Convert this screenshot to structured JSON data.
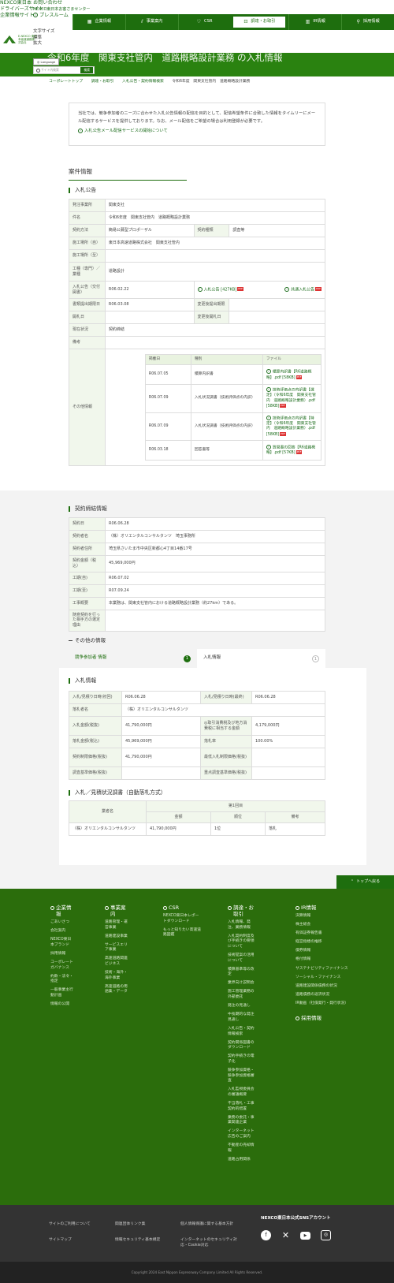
{
  "utility": {
    "links": [
      "NEXCO東日本",
      "ドライバーズサイト",
      "企業情報サイト",
      "お問い合わせ",
      "NEXCO東日本お客さまセンター",
      "プレスルーム"
    ],
    "font_size_label": "文字サイズ",
    "font_sizes": [
      "標準",
      "拡大"
    ],
    "logo_text": "E-NEXCO 東日本高速道路株式会社"
  },
  "gnav": {
    "items": [
      {
        "label": "企業情報",
        "icon": "building-icon"
      },
      {
        "label": "事業案内",
        "icon": "road-icon"
      },
      {
        "label": "CSR",
        "icon": "heart-icon"
      },
      {
        "label": "調達・お取引",
        "icon": "handshake-icon"
      },
      {
        "label": "IR情報",
        "icon": "chart-icon"
      },
      {
        "label": "採用情報",
        "icon": "person-icon"
      }
    ],
    "active_index": 3
  },
  "page": {
    "title": "令和6年度　関東支社管内　道路概略設計業務 の入札情報",
    "language_label": "Language",
    "search_placeholder": "サイト内検索",
    "search_button": "検索",
    "breadcrumb": [
      "コーポレートトップ",
      "調達・お取引",
      "入札公告・契約情報検索",
      "令和6年度　関東支社管内　道路概略設計業務"
    ]
  },
  "intro": {
    "text": "当社では、競争参加者のニーズに合わせた入札公告情報の配信を目的として、配信希望条件に合致した情報をタイムリーにメール配信するサービスを提供しております。なお、メール配信をご希望の場合は利用登録が必要です。",
    "link": "入札公告メール配信サービスの開始について"
  },
  "case": {
    "section_title": "案件情報",
    "subtitle": "入札公告",
    "rows": {
      "orderer_label": "発注事業所",
      "orderer": "関東支社",
      "name_label": "件名",
      "name": "令和6年度　関東支社管内　道路概略設計業務",
      "method_label": "契約方法",
      "method": "簡易公募型プロポーザル",
      "type_label": "契約種類",
      "type": "調査等",
      "place_from_label": "施工場所（自）",
      "place_from": "東日本高速道路株式会社　関東支社管内",
      "place_to_label": "施工場所（至）",
      "place_to": "",
      "work_label": "工種（専門）／業種",
      "work": "道路設計",
      "notice_label": "入札公告（交付図書）",
      "notice_date": "R06.02.22",
      "notice_file": "入札公告 [427KB]",
      "common_file": "共通入札公告",
      "deadline_label": "書類提出期限日",
      "deadline": "R06.03.08",
      "change_date_label": "変更後提出期限",
      "change_date": "",
      "open_label": "開札日",
      "open": "",
      "change_open_label": "変更後開札日",
      "change_open": "",
      "status_label": "現在状況",
      "status": "契約締結",
      "note_label": "備考",
      "note": "",
      "other_label": "その他情報"
    },
    "other_headers": [
      "掲載日",
      "種別",
      "ファイル"
    ],
    "other_rows": [
      {
        "date": "R06.07.05",
        "kind": "積算内訳書",
        "file": "積算内訳書【R6道路概略】.pdf [58KB]"
      },
      {
        "date": "R06.07.09",
        "kind": "入札状況調書（技術評価点の内訳）",
        "file": "技術評価点の内訳書【選定】（令和6年度　関東支社管内　道路概略設計業務）.pdf [58KB]"
      },
      {
        "date": "R06.07.09",
        "kind": "入札状況調書（技術評価点の内訳）",
        "file": "技術評価点の内訳書【特定】（令和6年度　関東支社管内　道路概略設計業務）.pdf [58KB]"
      },
      {
        "date": "R06.03.18",
        "kind": "回答書等",
        "file": "質問書の回答【R6道路概略】.pdf [57KB]"
      }
    ]
  },
  "contract": {
    "subtitle": "契約締結情報",
    "rows": [
      {
        "label": "契約日",
        "value": "R06.06.28"
      },
      {
        "label": "契約者名",
        "value": "（株）オリエンタルコンサルタンツ　埼玉事務所"
      },
      {
        "label": "契約者住所",
        "value": "埼玉県さいたま市中央区新都心4丁目14番17号"
      },
      {
        "label": "契約金額（税込）",
        "value": "45,969,000円"
      },
      {
        "label": "工期(自)",
        "value": "R06.07.02"
      },
      {
        "label": "工期(至)",
        "value": "R07.09.24"
      },
      {
        "label": "工事概要",
        "value": "本業務は、関東支社管内における道路概略設計業務（約27km）である。"
      },
      {
        "label": "随意契約を行った相手方の選定理由",
        "value": ""
      }
    ]
  },
  "other_info": {
    "title": "その他の情報",
    "tabs": [
      {
        "label": "競争参加者 情報",
        "count": "1"
      },
      {
        "label": "入札情報",
        "count": "1"
      }
    ]
  },
  "bid": {
    "subtitle": "入札情報",
    "rows": [
      [
        "入札/見積り日時(初回)",
        "R06.06.28",
        "入札/見積り日時(最終)",
        "R06.06.28"
      ],
      [
        "落札者名",
        "（株）オリエンタルコンサルタンツ",
        "",
        ""
      ],
      [
        "入札金額(税抜)",
        "41,790,000円",
        "◎取引消費税及び地方消費税に相当する金額",
        "4,179,000円"
      ],
      [
        "落札金額(税込)",
        "45,969,000円",
        "落札率",
        "100.00%"
      ],
      [
        "契約制限価格(税抜)",
        "41,790,000円",
        "最低入札制限価格(税抜)",
        ""
      ],
      [
        "調査基準価格(税抜)",
        "",
        "重点調査基準価格(税抜)",
        ""
      ]
    ]
  },
  "survey": {
    "subtitle": "入札／見積状況調書（自動落札方式）",
    "header_company": "業者名",
    "header_round": "第1回目",
    "header_cols": [
      "金額",
      "順位",
      "備考"
    ],
    "rows": [
      {
        "company": "（株）オリエンタルコンサルタンツ",
        "amount": "41,790,000円",
        "rank": "1位",
        "note": "落札"
      }
    ]
  },
  "totop": "トップへ戻る",
  "footer": {
    "cols": [
      {
        "title": "企業情報",
        "links": [
          "ごあいさつ",
          "会社案内",
          "NEXCO東日本ブランド",
          "採用情報",
          "コーポレートガバナンス",
          "約款・法令・指定",
          "一般事業主行動計画",
          "情報の公開"
        ]
      },
      {
        "title": "事業案内",
        "links": [
          "道路管理・運営事業",
          "道路建設事業",
          "サービスエリア事業",
          "高速道路関連ビジネス",
          "技術・海外・海外事業",
          "高速道路の用語集・データ"
        ]
      },
      {
        "title": "CSR",
        "links": [
          "NEXCO東日本レポートダウンロード",
          "もっと知りたい高速道路図鑑"
        ]
      },
      {
        "title": "調達・お取引",
        "links": [
          "入札情報、発注、業務情報",
          "入札契約制度及び手続きの要領について",
          "技術提案の活用について",
          "積算基準等の改定",
          "業界向け説明会",
          "施工管理業務の外部委託",
          "発注の見通し",
          "中長期的な発注見通し",
          "入札公告・契約情報検索",
          "契約関係図書のダウンロード",
          "契約手続きの電子化",
          "競争参加資格・競争参加資格審査",
          "入札監視委員会の審議概要",
          "不当落札・工事契約的措置",
          "業務の委託・事業関連企業",
          "インターネット広告のご案内",
          "不動産の売却情報",
          "道路占用関係"
        ]
      },
      {
        "title": "IR情報",
        "links": [
          "決算情報",
          "株主総会",
          "有価証券報告書",
          "経営指標の推移",
          "債券情報",
          "格付情報",
          "サステナビリティファイナンス",
          "ソーシャル・ファイナンス",
          "道路建設関係債務の状況",
          "道路債務の返済状況",
          "IR動画（社債発行・発行状況）"
        ]
      },
      {
        "title": "採用情報",
        "links": []
      }
    ],
    "bottom_links": [
      "サイトのご利用について",
      "サイトマップ",
      "関連団体リンク集",
      "情報セキュリティ基本規定",
      "個人情報保護に関する基本方針",
      "インターネットのセキュリティ対応・Cookie対応"
    ],
    "sns_title": "NEXCO東日本公式SNSアカウント",
    "sns": [
      "facebook-icon",
      "x-icon",
      "youtube-icon",
      "instagram-icon"
    ],
    "copyright": "Copyright 2024 East Nippon Expressway Company Limited All Rights Reserved."
  }
}
